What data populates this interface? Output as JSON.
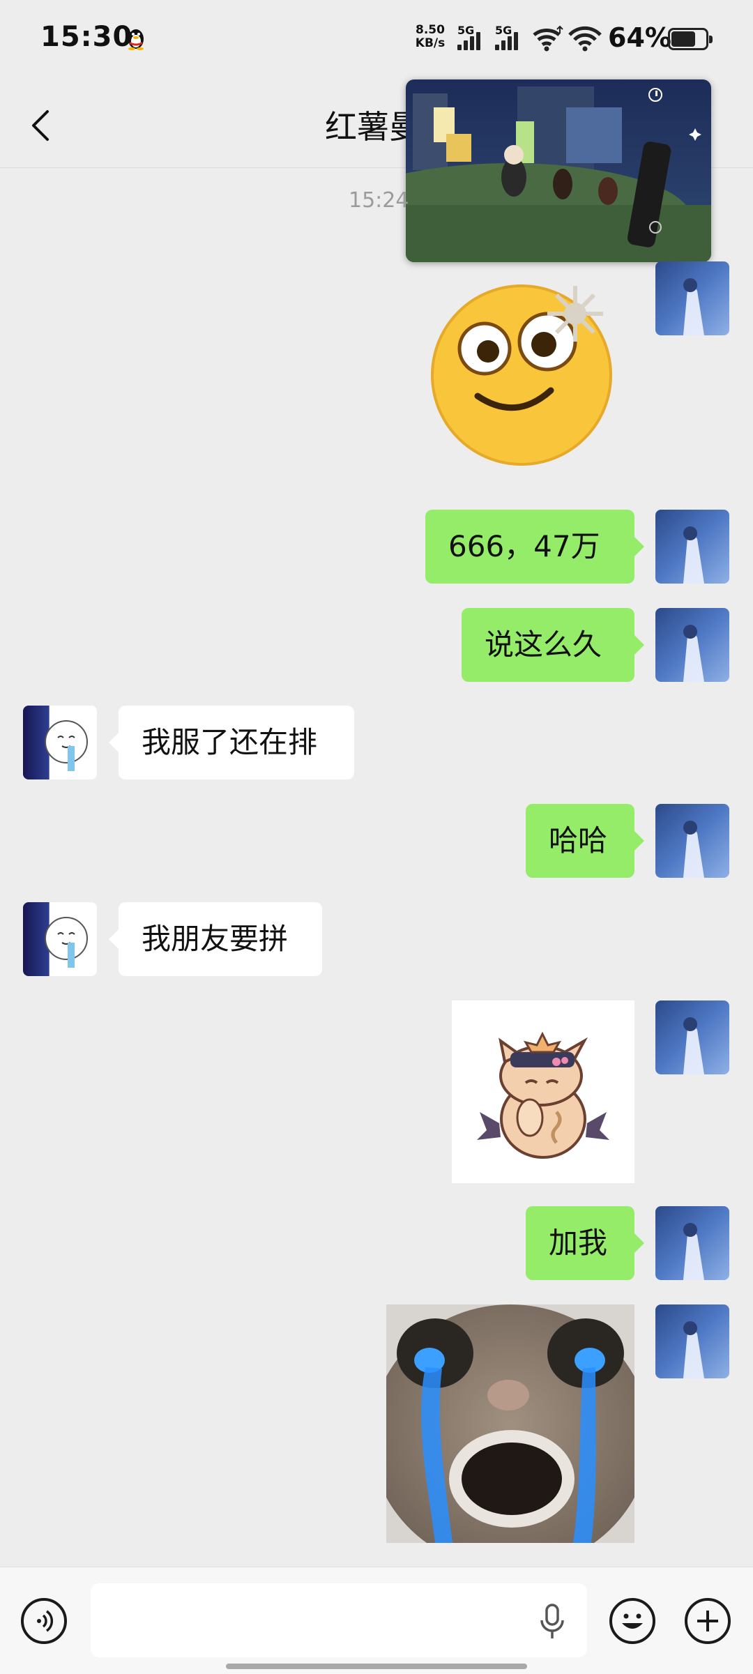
{
  "status_bar": {
    "time": "15:30",
    "net_speed_value": "8.50",
    "net_speed_unit": "KB/s",
    "signal_1_label": "5G",
    "signal_2_label": "5G",
    "battery_percent": "64%",
    "icons": [
      "qq-penguin-icon",
      "signal-icon",
      "signal-icon",
      "wifi-icon",
      "wifi-icon",
      "battery-icon"
    ]
  },
  "header": {
    "title": "红薯曼",
    "back_icon": "chevron-left-icon"
  },
  "chat": {
    "timestamp": "15:24",
    "messages": [
      {
        "side": "me",
        "type": "sticker",
        "sticker": "dazed-emoji-sticker"
      },
      {
        "side": "me",
        "type": "text",
        "text": "666，47万"
      },
      {
        "side": "me",
        "type": "text",
        "text": "说这么久"
      },
      {
        "side": "them",
        "type": "text",
        "text": "我服了还在排"
      },
      {
        "side": "me",
        "type": "text",
        "text": "哈哈"
      },
      {
        "side": "them",
        "type": "text",
        "text": "我朋友要拼"
      },
      {
        "side": "me",
        "type": "sticker",
        "sticker": "cartoon-cat-sticker"
      },
      {
        "side": "me",
        "type": "text",
        "text": "加我"
      },
      {
        "side": "me",
        "type": "sticker",
        "sticker": "crying-cat-sticker"
      }
    ]
  },
  "input_bar": {
    "placeholder": "",
    "icons": [
      "voice-icon",
      "mic-icon",
      "emoji-icon",
      "plus-icon"
    ]
  },
  "colors": {
    "background": "#ededed",
    "my_bubble": "#95ec69",
    "their_bubble": "#ffffff",
    "timestamp_text": "#9b9b9b"
  }
}
